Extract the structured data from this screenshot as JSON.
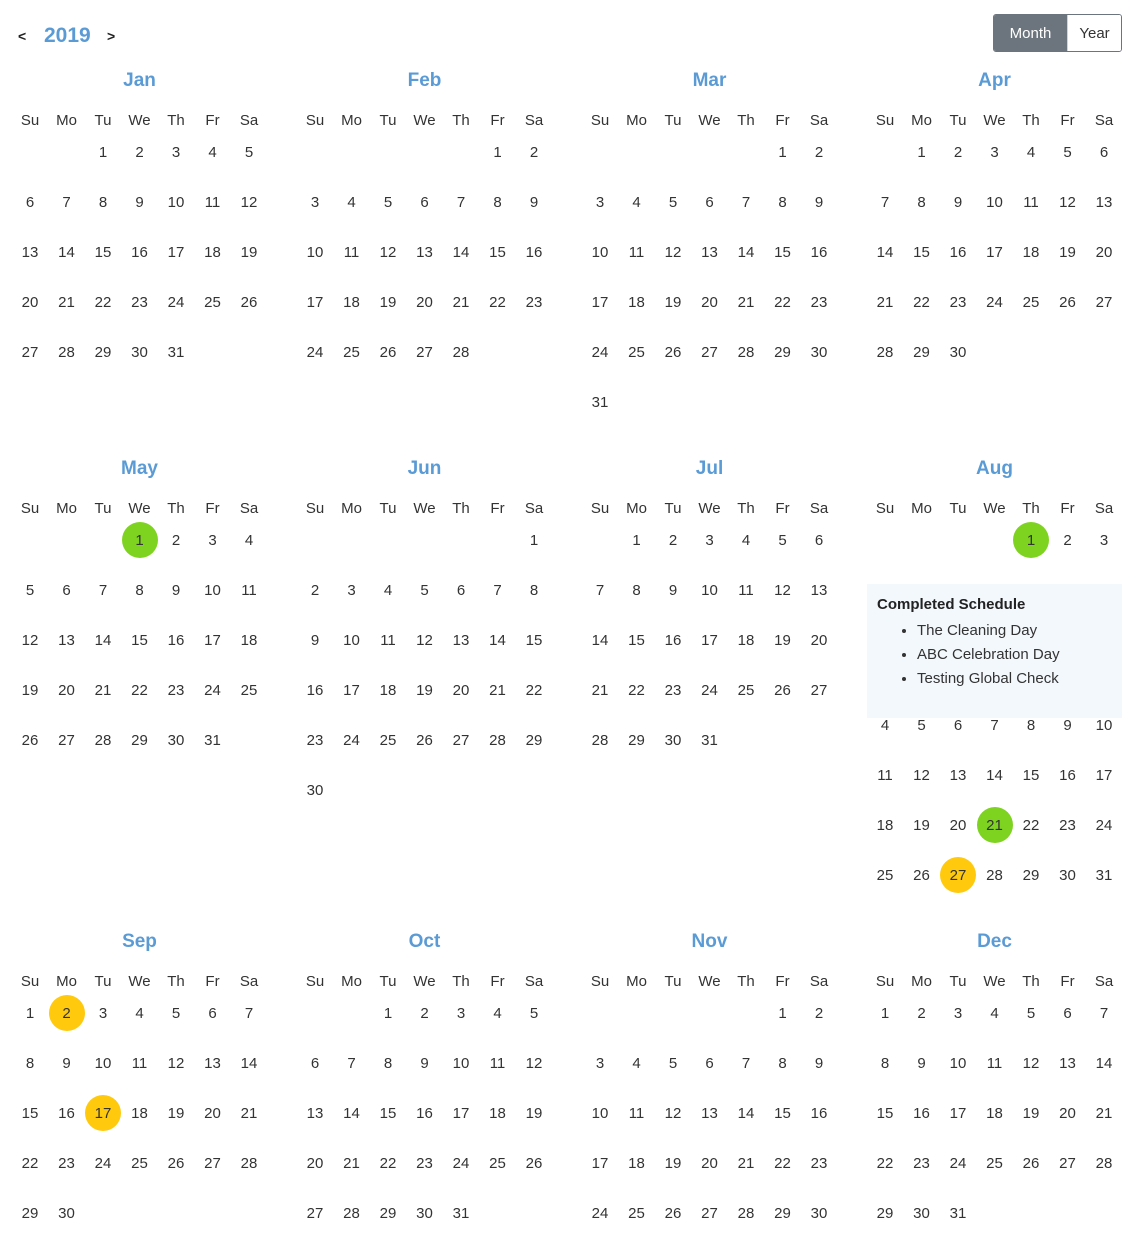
{
  "header": {
    "prev_label": "<",
    "next_label": ">",
    "year": "2019"
  },
  "view_toggle": {
    "month_label": "Month",
    "year_label": "Year",
    "active": "Month"
  },
  "weekdays": [
    "Su",
    "Mo",
    "Tu",
    "We",
    "Th",
    "Fr",
    "Sa"
  ],
  "months": [
    {
      "name": "Jan",
      "first_weekday": 2,
      "days": 31
    },
    {
      "name": "Feb",
      "first_weekday": 5,
      "days": 28
    },
    {
      "name": "Mar",
      "first_weekday": 5,
      "days": 31
    },
    {
      "name": "Apr",
      "first_weekday": 1,
      "days": 30
    },
    {
      "name": "May",
      "first_weekday": 3,
      "days": 31
    },
    {
      "name": "Jun",
      "first_weekday": 6,
      "days": 30
    },
    {
      "name": "Jul",
      "first_weekday": 1,
      "days": 31
    },
    {
      "name": "Aug",
      "first_weekday": 4,
      "days": 31
    },
    {
      "name": "Sep",
      "first_weekday": 0,
      "days": 30
    },
    {
      "name": "Oct",
      "first_weekday": 2,
      "days": 31
    },
    {
      "name": "Nov",
      "first_weekday": 5,
      "days": 30
    },
    {
      "name": "Dec",
      "first_weekday": 0,
      "days": 31
    }
  ],
  "highlights": [
    {
      "month": "May",
      "day": 1,
      "status": "completed"
    },
    {
      "month": "Aug",
      "day": 1,
      "status": "completed"
    },
    {
      "month": "Aug",
      "day": 21,
      "status": "completed"
    },
    {
      "month": "Aug",
      "day": 27,
      "status": "scheduled"
    },
    {
      "month": "Sep",
      "day": 2,
      "status": "scheduled"
    },
    {
      "month": "Sep",
      "day": 17,
      "status": "scheduled"
    }
  ],
  "status_colors": {
    "completed": "#7ed321",
    "scheduled": "#ffc90e"
  },
  "popup": {
    "month": "Aug",
    "day": 1,
    "title": "Completed Schedule",
    "items": [
      "The Cleaning Day",
      "ABC Celebration Day",
      "Testing Global Check"
    ]
  }
}
